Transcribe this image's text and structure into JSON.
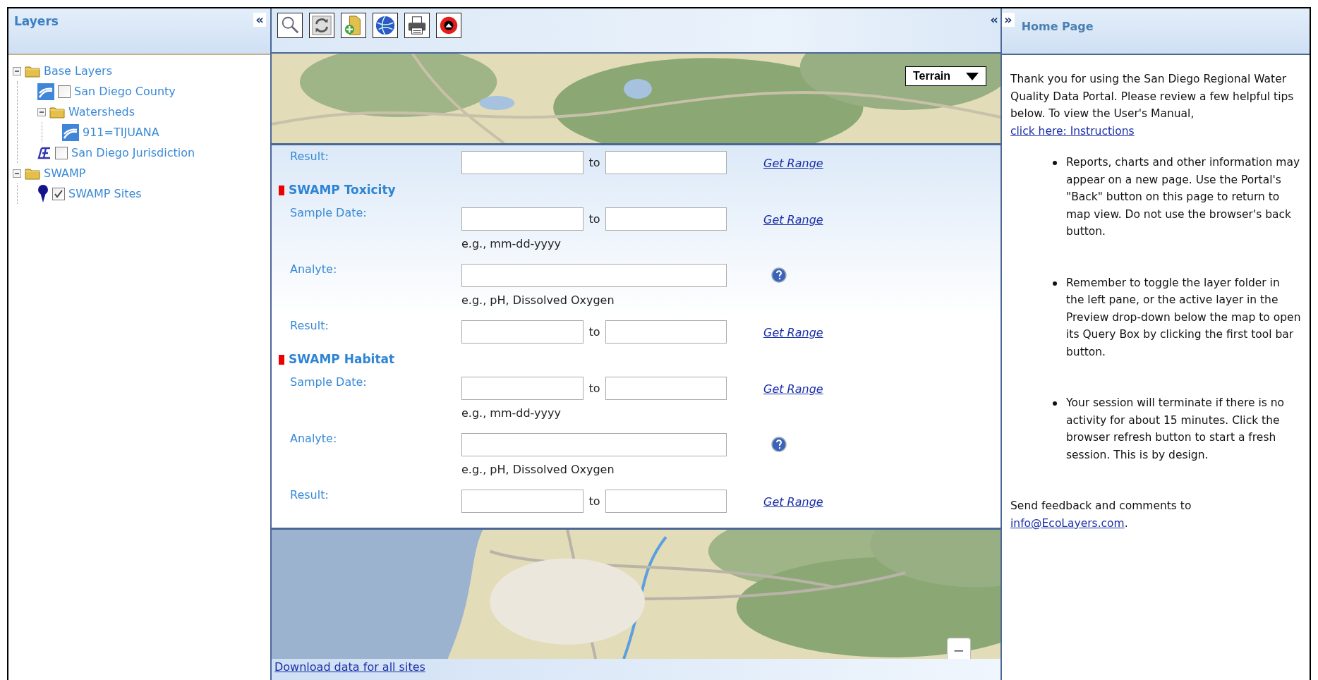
{
  "layers_panel": {
    "title": "Layers",
    "collapse": "«",
    "tree": [
      {
        "label": "Base Layers",
        "kind": "folder",
        "expanded": true,
        "children": [
          {
            "label": "San Diego County",
            "kind": "polygon",
            "checked": false
          },
          {
            "label": "Watersheds",
            "kind": "folder",
            "expanded": true,
            "children": [
              {
                "label": "911=TIJUANA",
                "kind": "polygon"
              }
            ]
          },
          {
            "label": "San Diego Jurisdiction",
            "kind": "line",
            "checked": false
          }
        ]
      },
      {
        "label": "SWAMP",
        "kind": "folder",
        "expanded": true,
        "children": [
          {
            "label": "SWAMP Sites",
            "kind": "point",
            "checked": true
          }
        ]
      }
    ]
  },
  "map_panel": {
    "collapse": "«",
    "map_type": "Terrain",
    "zoom_out": "−",
    "query_form": {
      "sections": [
        {
          "rows": [
            {
              "kind": "range",
              "label": "Result:",
              "joiner": "to",
              "link": "Get Range"
            }
          ]
        },
        {
          "title": "SWAMP Toxicity",
          "rows": [
            {
              "kind": "range",
              "label": "Sample Date:",
              "joiner": "to",
              "link": "Get Range"
            },
            {
              "kind": "hint",
              "text": "e.g., mm-dd-yyyy"
            },
            {
              "kind": "lookup",
              "label": "Analyte:"
            },
            {
              "kind": "hint",
              "text": "e.g., pH, Dissolved Oxygen"
            },
            {
              "kind": "range",
              "label": "Result:",
              "joiner": "to",
              "link": "Get Range"
            }
          ]
        },
        {
          "title": "SWAMP Habitat",
          "rows": [
            {
              "kind": "range",
              "label": "Sample Date:",
              "joiner": "to",
              "link": "Get Range"
            },
            {
              "kind": "hint",
              "text": "e.g., mm-dd-yyyy"
            },
            {
              "kind": "lookup",
              "label": "Analyte:"
            },
            {
              "kind": "hint",
              "text": "e.g., pH, Dissolved Oxygen"
            },
            {
              "kind": "range",
              "label": "Result:",
              "joiner": "to",
              "link": "Get Range"
            }
          ]
        }
      ]
    },
    "download_link": "Download data for all sites"
  },
  "home_panel": {
    "expand": "»",
    "title": "Home Page",
    "intro": "Thank you for using the San Diego Regional Water Quality Data Portal. Please review a few helpful tips below. To view the User's Manual,",
    "intro_link": "click here: Instructions",
    "tips": [
      "Reports, charts and other information may appear on a new page. Use the Portal's \"Back\" button on this page to return to map view. Do not use the browser's back button.",
      "Remember to toggle the layer folder in the left pane, or the active layer in the Preview drop-down below the map to open its Query Box by clicking the first tool bar button.",
      "Your session will terminate if there is no activity for about 15 minutes. Click the browser refresh button to start a fresh session. This is by design."
    ],
    "feedback": "Send feedback and comments to",
    "feedback_link": "info@EcoLayers.com",
    "feedback_end": "."
  }
}
